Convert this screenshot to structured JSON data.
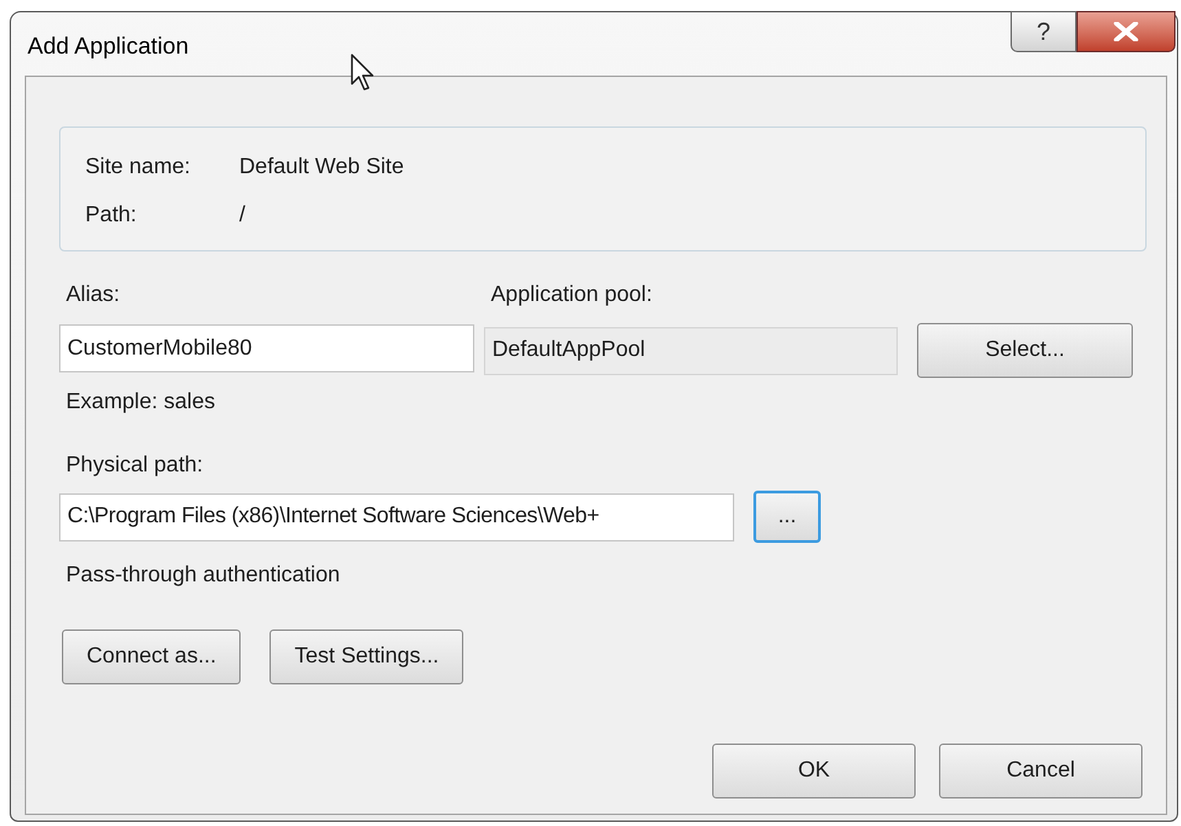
{
  "window": {
    "title": "Add Application",
    "help_button": "?"
  },
  "site_info": [
    {
      "label": "Site name:",
      "value": "Default Web Site"
    },
    {
      "label": "Path:",
      "value": "/"
    }
  ],
  "alias": {
    "label": "Alias:",
    "value": "CustomerMobile80",
    "hint": "Example: sales"
  },
  "application_pool": {
    "label": "Application pool:",
    "value": "DefaultAppPool",
    "button": "Select..."
  },
  "physical_path": {
    "label": "Physical path:",
    "value": "C:\\Program Files (x86)\\Internet Software Sciences\\Web+",
    "browse_button": "..."
  },
  "authentication": "Pass-through authentication",
  "action_buttons": [
    "Connect as...",
    "Test Settings..."
  ],
  "dialog_buttons": [
    "OK",
    "Cancel"
  ]
}
